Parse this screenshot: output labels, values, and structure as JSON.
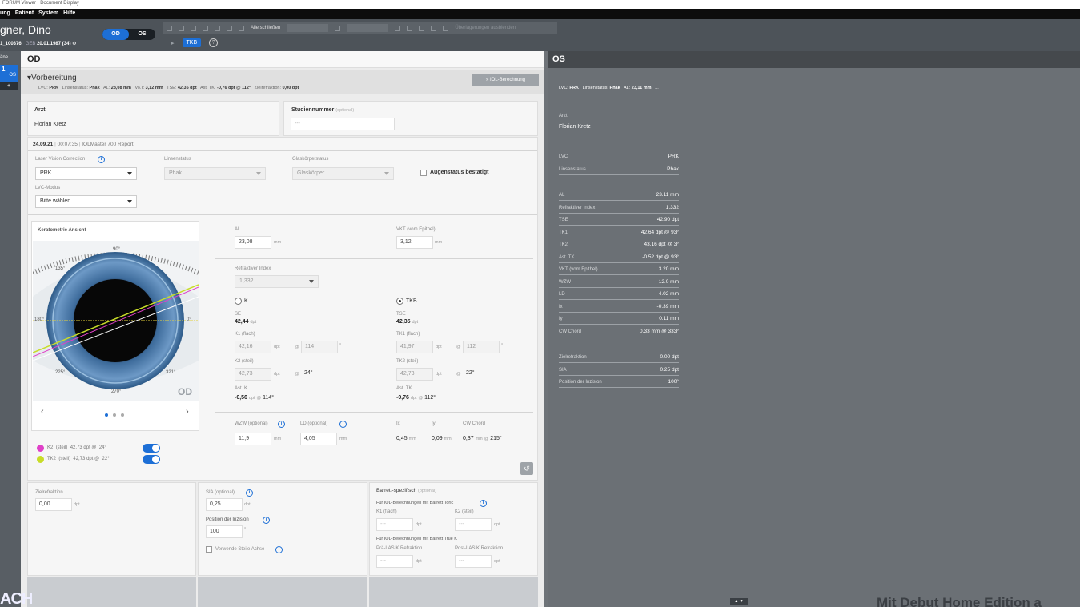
{
  "window": {
    "title": "FORUM Viewer · Document Display"
  },
  "menu": [
    "ung",
    "Patient",
    "System",
    "Hilfe"
  ],
  "patient": {
    "name": "gner, Dino",
    "id": "1_100376",
    "geb_label": "GEB",
    "dob": "20.01.1987",
    "age": "(34)"
  },
  "eye_toggle": {
    "od": "OD",
    "os": "OS"
  },
  "toolbar": {
    "close_all": "Alle schließen",
    "overlay": "Überlagerungen ausblenden"
  },
  "tkb": {
    "arrow": "▸",
    "label": "TKB",
    "help": "?"
  },
  "left_strip": {
    "plane_label": "äne",
    "item_num": "1",
    "item_eye": "OS",
    "plus": "+"
  },
  "od": {
    "title": "OD",
    "prep_title": "Vorbereitung",
    "summary": {
      "lvc_label": "LVC:",
      "lvc": "PRK",
      "ls_label": "Linsenstatus:",
      "ls": "Phak",
      "al_label": "AL:",
      "al": "23,08 mm",
      "vkt_label": "VKT:",
      "vkt": "3,12 mm",
      "tse_label": "TSE:",
      "tse": "42,35 dpt",
      "ast_label": "Ast. TK:",
      "ast": "-0,76 dpt @ 112°",
      "ziel_label": "Zielrefraktion:",
      "ziel": "0,00 dpt"
    },
    "iol_button": "» IOL-Berechnung",
    "arzt_label": "Arzt",
    "arzt_value": "Florian Kretz",
    "studien_label": "Studiennummer",
    "studien_optional": "(optional)",
    "studien_placeholder": "---",
    "report_date": "24.09.21",
    "report_time": "00:07:35",
    "report_device": "IOLMaster 700 Report",
    "lvc_label": "Laser Vision Correction",
    "lvc_value": "PRK",
    "linsenstatus_label": "Linsenstatus",
    "linsenstatus_value": "Phak",
    "glaskoerper_label": "Glaskörperstatus",
    "glaskoerper_value": "Glaskörper",
    "augenstatus_label": "Augenstatus bestätigt",
    "lvc_modus_label": "LVC-Modus",
    "lvc_modus_value": "Bitte wählen",
    "kerat_title": "Keratometrie Ansicht",
    "eye_label": "OD",
    "eye_degrees": {
      "top": "90°",
      "tl": "135°",
      "left": "180°",
      "right": "0°",
      "bl": "225°",
      "br": "321°",
      "bottom": "270°"
    },
    "nav_prev": "‹",
    "nav_next": "›",
    "legend": [
      {
        "name": "K2",
        "type": "(steil)",
        "value": "42,73",
        "unit": "dpt",
        "at": "@",
        "axis": "24°",
        "color": "#e040c8"
      },
      {
        "name": "TK2",
        "type": "(steil)",
        "value": "42,73",
        "unit": "dpt",
        "at": "@",
        "axis": "22°",
        "color": "#c8dc28"
      }
    ],
    "al_label": "AL",
    "al_value": "23,08",
    "mm": "mm",
    "vkt_label": "VKT (vom Epithel)",
    "vkt_value": "3,12",
    "refr_label": "Refraktiver Index",
    "refr_value": "1,332",
    "k_label": "K",
    "tkb_label": "TKB",
    "se_label": "SE",
    "se_value": "42,44",
    "dpt": "dpt",
    "tse_label": "TSE",
    "tse_value": "42,35",
    "k1_label": "K1 (flach)",
    "k1_value": "42,16",
    "k1_axis": "114",
    "at": "@",
    "deg": "°",
    "tk1_label": "TK1 (flach)",
    "tk1_value": "41,97",
    "tk1_axis": "112",
    "k2_label": "K2 (steil)",
    "k2_value": "42,73",
    "k2_axis": "24°",
    "tk2_label": "TK2 (steil)",
    "tk2_value": "42,73",
    "tk2_axis": "22°",
    "astk_label": "Ast. K",
    "astk_value": "-0,56",
    "astk_axis": "114°",
    "asttk_label": "Ast. TK",
    "asttk_value": "-0,76",
    "asttk_axis": "112°",
    "wzw_label": "WZW (optional)",
    "wzw_value": "11,9",
    "ld_label": "LD (optional)",
    "ld_value": "4,05",
    "ix_label": "Ix",
    "ix_value": "0,45",
    "iy_label": "Iy",
    "iy_value": "0,09",
    "cw_label": "CW Chord",
    "cw_value": "0,37",
    "cw_axis": "215°",
    "reset_icon": "↺",
    "ziel_label": "Zielrefraktion",
    "ziel_value": "0,00",
    "sia_label": "SIA (optional)",
    "sia_value": "0,25",
    "pos_label": "Position der Inzision",
    "pos_value": "100",
    "steile_label": "Verwende Steile Achse",
    "barrett_title": "Barrett-spezifisch",
    "barrett_optional": "(optional)",
    "barrett_toric": "Für IOL-Berechnungen mit Barrett Toric",
    "k1_flach": "K1 (flach)",
    "k2_steil": "K2 (steil)",
    "barrett_truek": "Für IOL-Berechnungen mit Barrett True K",
    "pre_lasik": "Prä-LASIK Refraktion",
    "post_lasik": "Post-LASIK Refraktion",
    "placeholder_dash": "---"
  },
  "os": {
    "title": "OS",
    "summary": {
      "lvc_label": "LVC:",
      "lvc": "PRK",
      "ls_label": "Linsenstatus:",
      "ls": "Phak",
      "al_label": "AL:",
      "al": "23,11 mm",
      "more": "..."
    },
    "arzt_label": "Arzt",
    "arzt_value": "Florian Kretz",
    "group1": [
      {
        "label": "LVC",
        "value": "PRK"
      },
      {
        "label": "Linsenstatus",
        "value": "Phak"
      }
    ],
    "group2": [
      {
        "label": "AL",
        "value": "23.11 mm"
      },
      {
        "label": "Refraktiver Index",
        "value": "1.332"
      },
      {
        "label": "TSE",
        "value": "42.90 dpt"
      },
      {
        "label": "TK1",
        "value": "42.64 dpt @  93°"
      },
      {
        "label": "TK2",
        "value": "43.16 dpt @   3°"
      },
      {
        "label": "Ast. TK",
        "value": "-0.52 dpt @  93°"
      },
      {
        "label": "VKT (vom Epithel)",
        "value": "3.20 mm"
      },
      {
        "label": "WZW",
        "value": "12.0 mm"
      },
      {
        "label": "LD",
        "value": "4.02 mm"
      },
      {
        "label": "Ix",
        "value": "-0.39 mm"
      },
      {
        "label": "Iy",
        "value": "0.11 mm"
      },
      {
        "label": "CW Chord",
        "value": "0.33 mm @ 333°"
      }
    ],
    "group3": [
      {
        "label": "Zielrefraktion",
        "value": "0.00 dpt"
      },
      {
        "label": "SIA",
        "value": "0.25 dpt"
      },
      {
        "label": "Position der Inzision",
        "value": "100°"
      }
    ]
  },
  "scroll_buttons": "▲ ▼",
  "watermark": "Mit Debut Home Edition a",
  "corner_logo": "ACH"
}
